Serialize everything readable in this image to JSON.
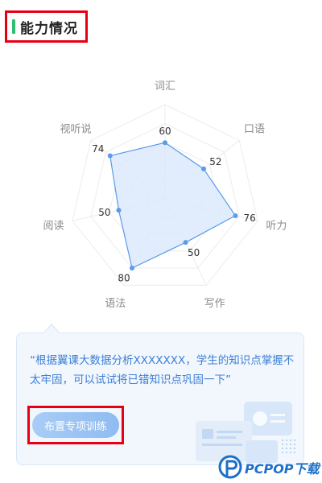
{
  "section": {
    "title": "能力情况",
    "accent_color": "#2fbf71",
    "highlight_color": "#e60012"
  },
  "chart_data": {
    "type": "radar",
    "axes": [
      "词汇",
      "口语",
      "听力",
      "写作",
      "语法",
      "阅读",
      "视听说"
    ],
    "values": [
      60,
      52,
      76,
      50,
      80,
      50,
      74
    ],
    "max": 100,
    "series_color": "#5b9be8",
    "fill_color": "#dce9fb"
  },
  "feedback": {
    "text": "“根据翼课大数据分析XXXXXXX，学生的知识点掌握不太牢固，可以试试将已错知识点巩固一下”",
    "button_label": "布置专项训练",
    "text_color": "#3d7fd6"
  },
  "watermark": {
    "logo_text": "PCPOP下载"
  }
}
